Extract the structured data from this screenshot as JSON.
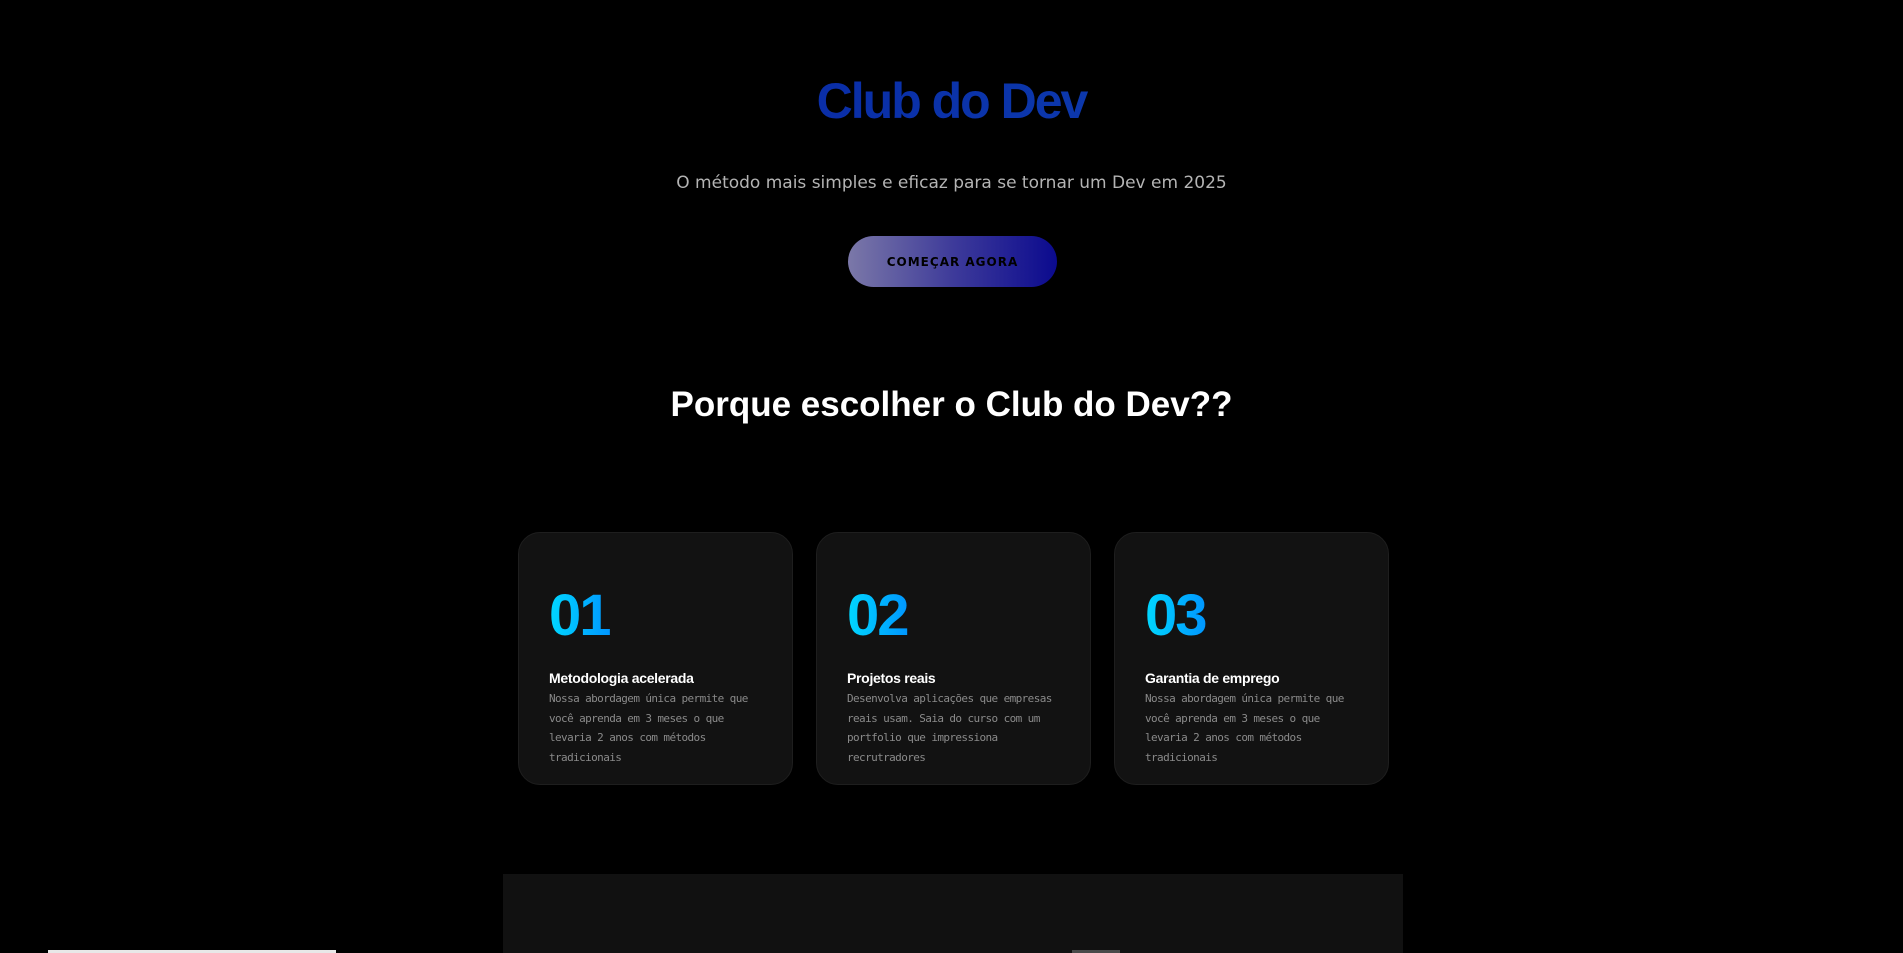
{
  "hero": {
    "title": "Club do Dev",
    "subtitle": "O método mais simples e eficaz para se tornar um Dev em 2025",
    "cta_label": "COMEÇAR AGORA"
  },
  "features": {
    "heading": "Porque escolher o Club do Dev??",
    "cards": [
      {
        "number": "01",
        "title": "Metodologia acelerada",
        "text": "Nossa abordagem única permite que você aprenda em 3 meses o que levaria 2 anos com métodos tradicionais"
      },
      {
        "number": "02",
        "title": "Projetos reais",
        "text": "Desenvolva aplicações que empresas reais usam. Saia do curso com um portfolio que impressiona recrutradores"
      },
      {
        "number": "03",
        "title": "Garantia de emprego",
        "text": "Nossa abordagem única permite que você aprenda em 3 meses o que levaria 2 anos com métodos tradicionais"
      }
    ]
  },
  "colors": {
    "background": "#000000",
    "card_background": "#121212",
    "title_gradient": [
      "#0b0f8a",
      "#1256b8"
    ],
    "number_gradient": [
      "#00d8ff",
      "#0096ff"
    ],
    "button_gradient": [
      "#7b78a8",
      "#0b0a8e"
    ]
  }
}
